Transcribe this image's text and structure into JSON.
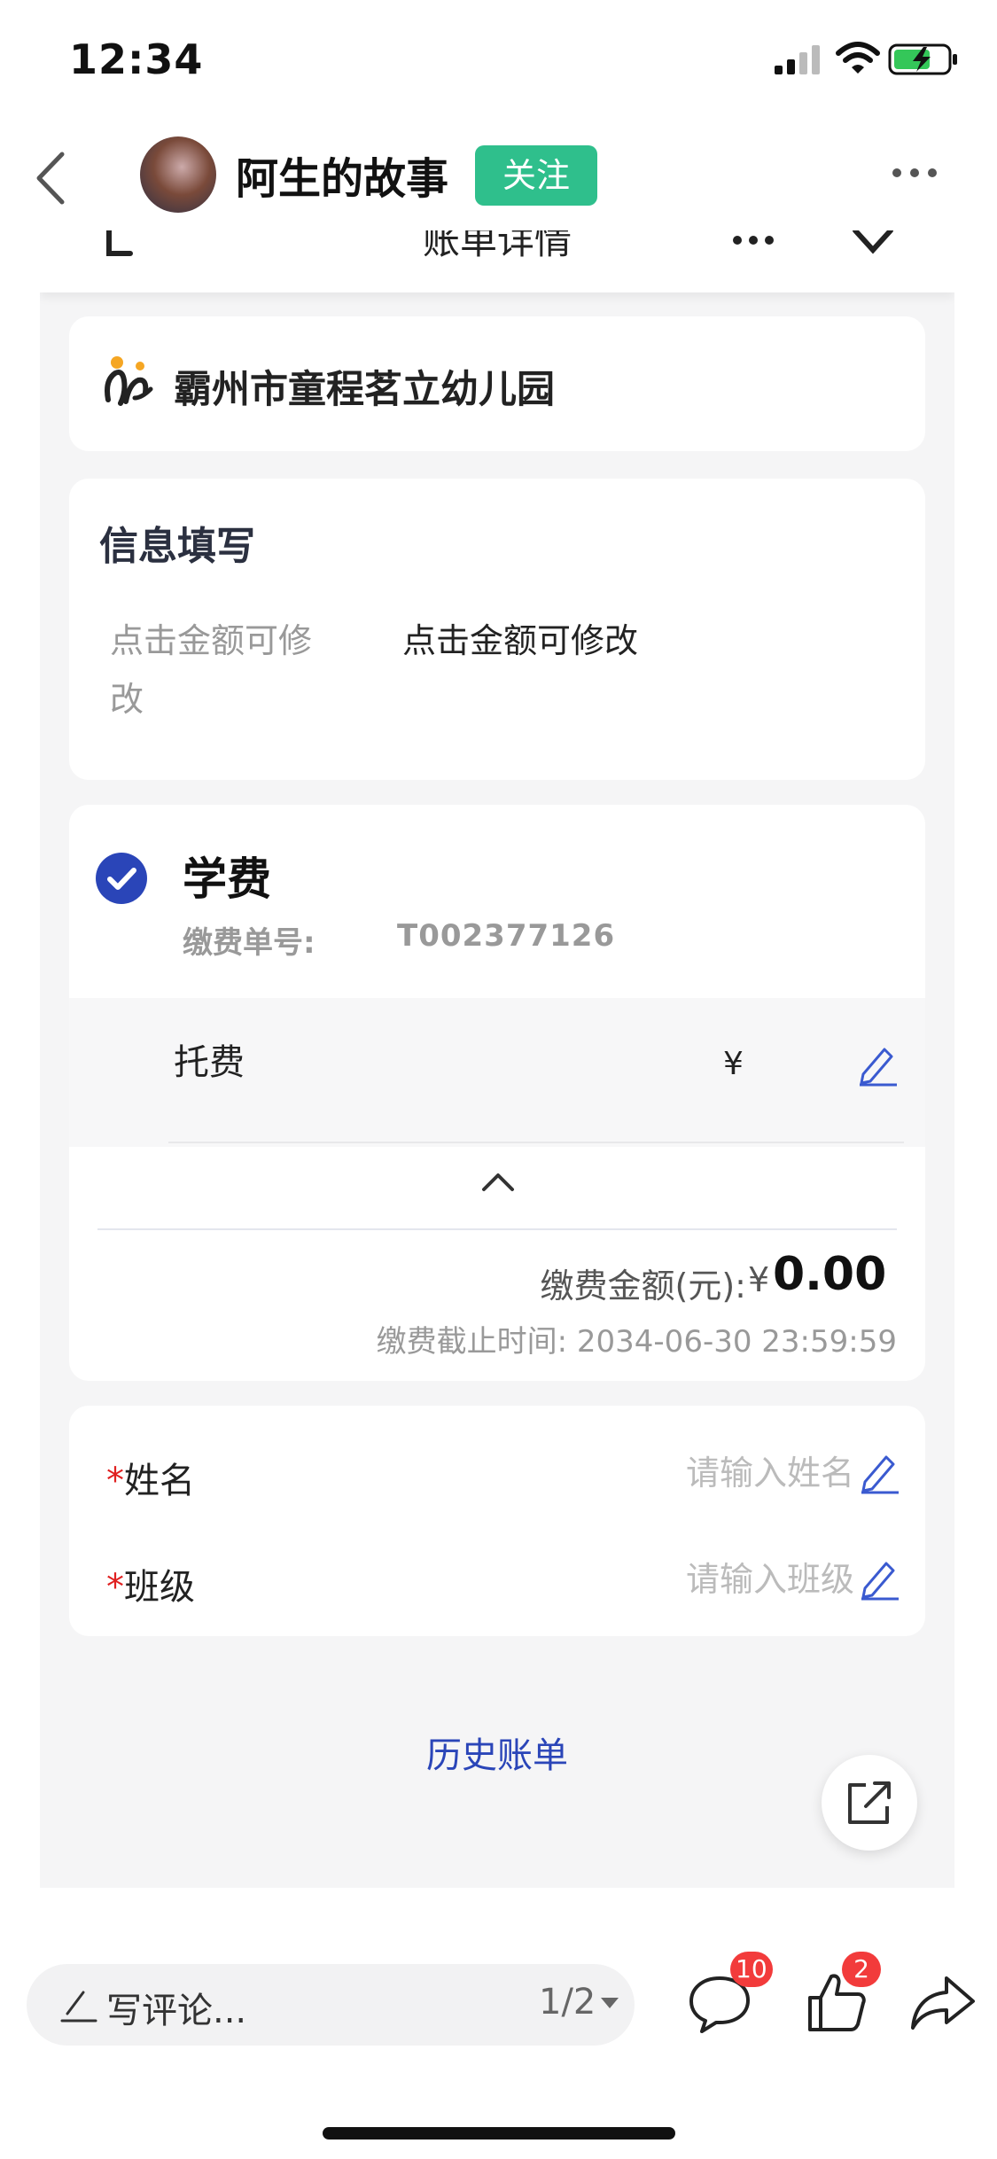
{
  "status_bar": {
    "time": "12:34"
  },
  "header": {
    "author": "阿生的故事",
    "follow_label": "关注"
  },
  "embedded": {
    "title": "账单详情",
    "school": {
      "name": "霸州市童程茗立幼儿园"
    },
    "info": {
      "title": "信息填写",
      "label": "点击金额可修改",
      "value": "点击金额可修改"
    },
    "fee": {
      "title": "学费",
      "no_label": "缴费单号:",
      "no": "T002377126",
      "item_name": "托费",
      "item_currency": "¥",
      "amount_label": "缴费金额(元):",
      "amount_currency": "¥",
      "amount": "0.00",
      "deadline": "缴费截止时间: 2034-06-30 23:59:59"
    },
    "form": {
      "name_required": "*",
      "name_label": "姓名",
      "name_placeholder": "请输入姓名",
      "class_required": "*",
      "class_label": "班级",
      "class_placeholder": "请输入班级"
    },
    "history_link": "历史账单"
  },
  "bottom_bar": {
    "comment_placeholder": "写评论...",
    "page_indicator": "1/2",
    "comment_count": "10",
    "like_count": "2"
  },
  "colors": {
    "follow_green": "#2fbf8c",
    "accent_blue": "#2a45b8",
    "badge_red": "#f23b3b",
    "required_red": "#e02020"
  }
}
